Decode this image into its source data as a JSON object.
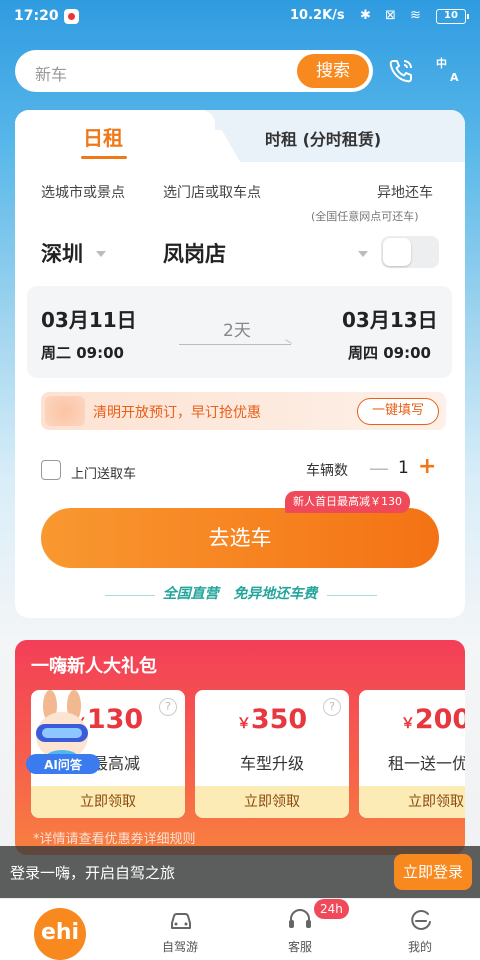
{
  "status_bar": {
    "time": "17:20",
    "network_speed": "10.2K/s",
    "battery": "10"
  },
  "search": {
    "placeholder": "新车",
    "button_label": "搜索"
  },
  "booking": {
    "tabs": {
      "daily": "日租",
      "hourly": "时租 (分时租赁)"
    },
    "city_label": "选城市或景点",
    "store_label": "选门店或取车点",
    "return_label": "异地还车",
    "return_note": "(全国任意网点可还车)",
    "city_value": "深圳",
    "store_value": "凤岗店",
    "pickup": {
      "date": "03月11日",
      "weekday_time": "周二 09:00"
    },
    "dropoff": {
      "date": "03月13日",
      "weekday_time": "周四 09:00"
    },
    "duration": "2天",
    "promo_text": "清明开放预订，早订抢优惠",
    "promo_button": "一键填写",
    "door_service_label": "上门送取车",
    "car_count_label": "车辆数",
    "car_count_minus": "—",
    "car_count": "1",
    "car_count_plus": "+",
    "newbie_tag": "新人首日最高减￥130",
    "select_car_button": "去选车",
    "slogan_left": "全国直营",
    "slogan_right": "免异地还车费"
  },
  "gift_pack": {
    "title": "一嗨新人大礼包",
    "coupons": [
      {
        "currency": "￥",
        "amount": "130",
        "desc": "日最高减",
        "claim": "立即领取"
      },
      {
        "currency": "￥",
        "amount": "350",
        "desc": "车型升级",
        "claim": "立即领取"
      },
      {
        "currency": "￥",
        "amount": "200",
        "desc": "租一送一优惠",
        "claim": "立即领取"
      }
    ],
    "note": "*详情请查看优惠券详细规则",
    "mascot_label": "AI问答"
  },
  "login_banner": {
    "text": "登录一嗨，开启自驾之旅",
    "button": "立即登录"
  },
  "bottom_nav": {
    "home_logo": "ehi",
    "items": [
      {
        "label": "自驾游"
      },
      {
        "label": "客服",
        "badge": "24h"
      },
      {
        "label": "我的"
      }
    ]
  },
  "colors": {
    "accent": "#f7891f",
    "promo_red": "#f04a5a",
    "teal": "#24a59c"
  }
}
